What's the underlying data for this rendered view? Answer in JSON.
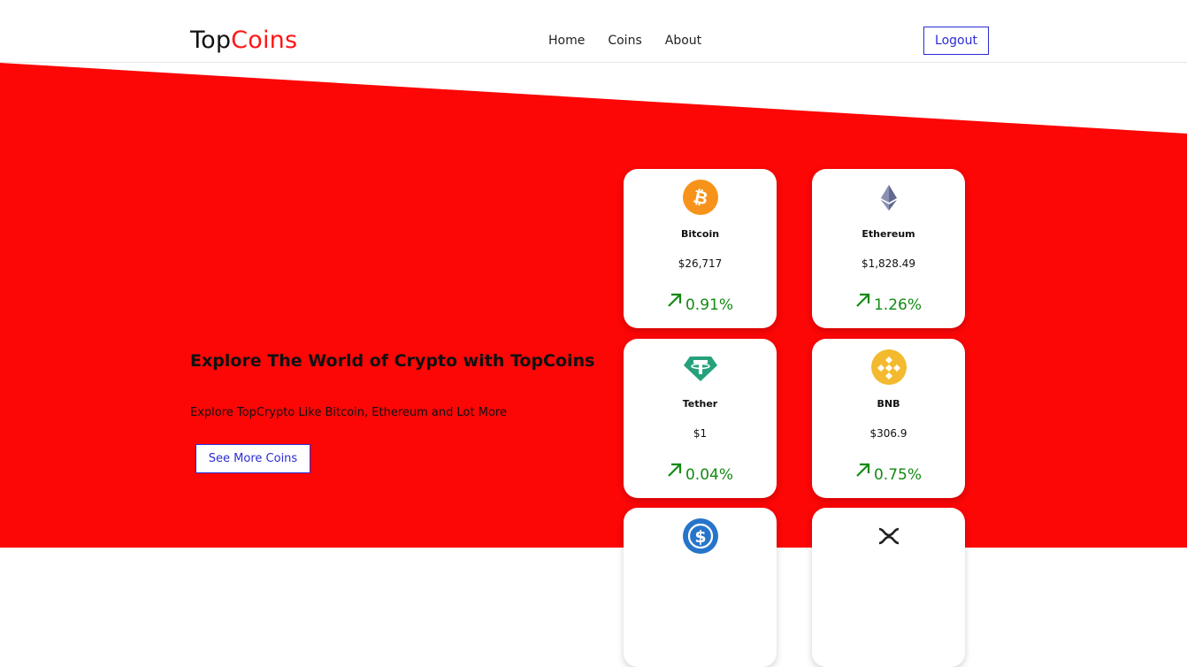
{
  "brand": {
    "part1": "Top",
    "part2": "Coins"
  },
  "nav": {
    "home": "Home",
    "coins": "Coins",
    "about": "About"
  },
  "logout_label": "Logout",
  "hero": {
    "title": "Explore The World of Crypto with TopCoins",
    "subtitle": "Explore TopCrypto Like Bitcoin, Ethereum and Lot More",
    "button_label": "See More Coins"
  },
  "colors": {
    "accent": "#fc0606",
    "button": "#2b2bd6",
    "positive": "#138a13"
  },
  "coins": [
    {
      "name": "Bitcoin",
      "price": "$26,717",
      "change": "0.91%",
      "icon": "bitcoin-icon"
    },
    {
      "name": "Ethereum",
      "price": "$1,828.49",
      "change": "1.26%",
      "icon": "ethereum-icon"
    },
    {
      "name": "Tether",
      "price": "$1",
      "change": "0.04%",
      "icon": "tether-icon"
    },
    {
      "name": "BNB",
      "price": "$306.9",
      "change": "0.75%",
      "icon": "bnb-icon"
    },
    {
      "icon": "usdc-icon"
    },
    {
      "icon": "xrp-icon"
    }
  ]
}
